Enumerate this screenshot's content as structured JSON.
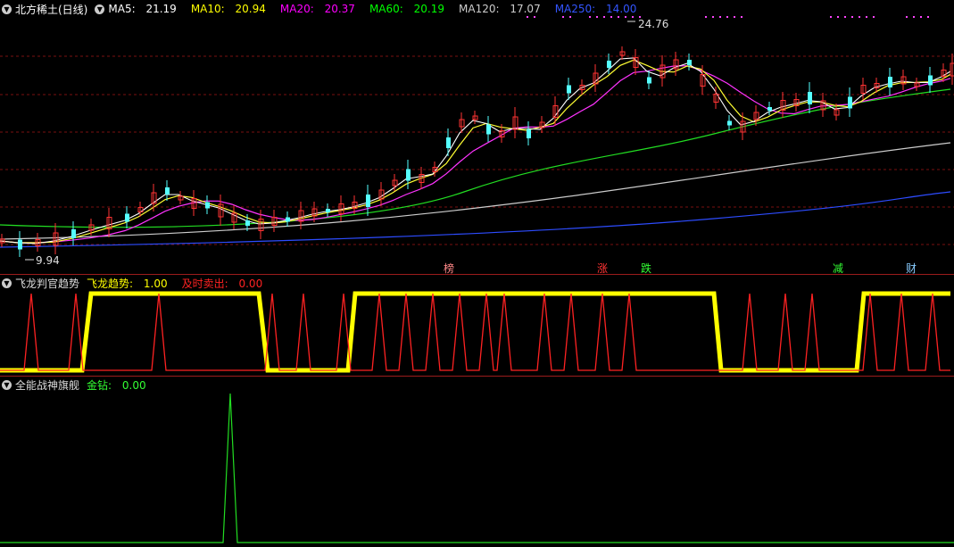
{
  "stock": {
    "title": "北方稀土(日线)"
  },
  "ma_legend": [
    {
      "label": "MA5:",
      "value": "21.19",
      "color": "#ffffff"
    },
    {
      "label": "MA10:",
      "value": "20.94",
      "color": "#ffff00"
    },
    {
      "label": "MA20:",
      "value": "20.37",
      "color": "#ff00ff"
    },
    {
      "label": "MA60:",
      "value": "20.19",
      "color": "#00ff00"
    },
    {
      "label": "MA120:",
      "value": "17.07",
      "color": "#cccccc"
    },
    {
      "label": "MA250:",
      "value": "14.00",
      "color": "#3355ff"
    }
  ],
  "price_annotations": {
    "high": "24.76",
    "low": "9.94"
  },
  "events": [
    {
      "label": "榜",
      "color": "#ff8888"
    },
    {
      "label": "涨",
      "color": "#ff3333"
    },
    {
      "label": "跌",
      "color": "#33ff33"
    },
    {
      "label": "减",
      "color": "#33ff33"
    },
    {
      "label": "财",
      "color": "#88ccff"
    }
  ],
  "panel2": {
    "title": "飞龙判官趋势",
    "items": [
      {
        "label": "飞龙趋势:",
        "value": "1.00",
        "color": "#ffff00"
      },
      {
        "label": "及时卖出:",
        "value": "0.00",
        "color": "#ff2222"
      }
    ]
  },
  "panel3": {
    "title": "全能战神旗舰",
    "items": [
      {
        "label": "金钻:",
        "value": "0.00",
        "color": "#33ff33"
      }
    ]
  },
  "colors": {
    "up": "#ff3333",
    "down": "#55ffff",
    "background": "#000000"
  },
  "chart_data": {
    "type": "candlestick",
    "price_high": 24.76,
    "price_low": 9.94,
    "series": [
      {
        "name": "MA5",
        "last": 21.19
      },
      {
        "name": "MA10",
        "last": 20.94
      },
      {
        "name": "MA20",
        "last": 20.37
      },
      {
        "name": "MA60",
        "last": 20.19
      },
      {
        "name": "MA120",
        "last": 17.07
      },
      {
        "name": "MA250",
        "last": 14.0
      }
    ]
  }
}
